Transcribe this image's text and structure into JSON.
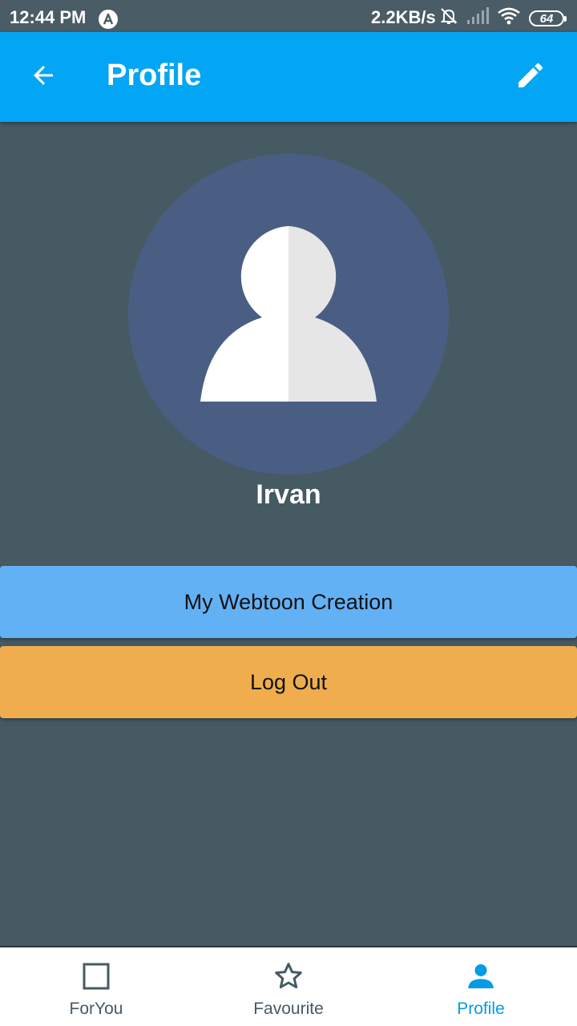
{
  "status_bar": {
    "time": "12:44 PM",
    "net_speed": "2.2KB/s",
    "battery": "64",
    "icons": [
      "app-notification-icon",
      "mute-bell-icon",
      "signal-icon",
      "wifi-icon",
      "battery-icon"
    ]
  },
  "app_bar": {
    "title": "Profile",
    "back_icon": "arrow-back-icon",
    "edit_icon": "pencil-edit-icon"
  },
  "profile": {
    "name": "Irvan",
    "avatar_icon": "person-silhouette-icon"
  },
  "actions": {
    "creation_label": "My Webtoon Creation",
    "logout_label": "Log Out"
  },
  "bottom_nav": {
    "items": [
      {
        "label": "ForYou",
        "icon": "square-outline-icon",
        "active": false
      },
      {
        "label": "Favourite",
        "icon": "star-outline-icon",
        "active": false
      },
      {
        "label": "Profile",
        "icon": "person-icon",
        "active": true
      }
    ]
  },
  "colors": {
    "background": "#465a63",
    "app_bar": "#03a6f4",
    "avatar_circle": "#4a5e84",
    "creation_button": "#63b1f5",
    "logout_button": "#efad4d",
    "nav_active": "#039be5",
    "nav_inactive": "#455a64"
  }
}
